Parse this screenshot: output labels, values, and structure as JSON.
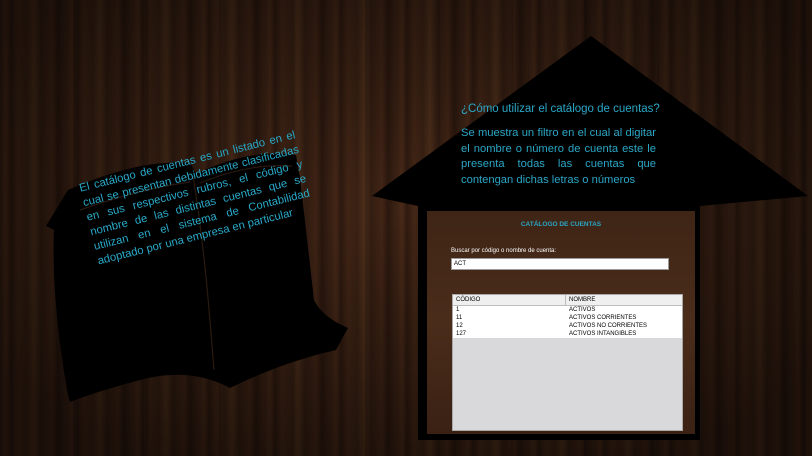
{
  "book": {
    "text": "El catálogo de cuentas es un listado en el cual se presentan debidamente clasificadas en sus respectivos rubros, el código y nombre de las distintas cuentas que se utilizan en el sistema de Contabilidad adoptado por una empresa en particular"
  },
  "house": {
    "title": "¿Cómo utilizar el catálogo de cuentas?",
    "description": "Se muestra un filtro en el cual al digitar el nombre o número de cuenta este le presenta todas las cuentas que contengan dichas letras o números"
  },
  "app": {
    "title": "CATÁLOGO DE CUENTAS",
    "search_label": "Buscar por código o nombre de cuenta:",
    "search_value": "ACT",
    "columns": [
      "CÓDIGO",
      "NOMBRE"
    ],
    "rows": [
      {
        "codigo": "1",
        "nombre": "ACTIVOS"
      },
      {
        "codigo": "11",
        "nombre": "ACTIVOS CORRIENTES"
      },
      {
        "codigo": "12",
        "nombre": "ACTIVOS NO CORRIENTES"
      },
      {
        "codigo": "127",
        "nombre": "ACTIVOS INTANGIBLES"
      }
    ]
  },
  "colors": {
    "accent_text": "#2aa7c6",
    "silhouette": "#000000"
  }
}
